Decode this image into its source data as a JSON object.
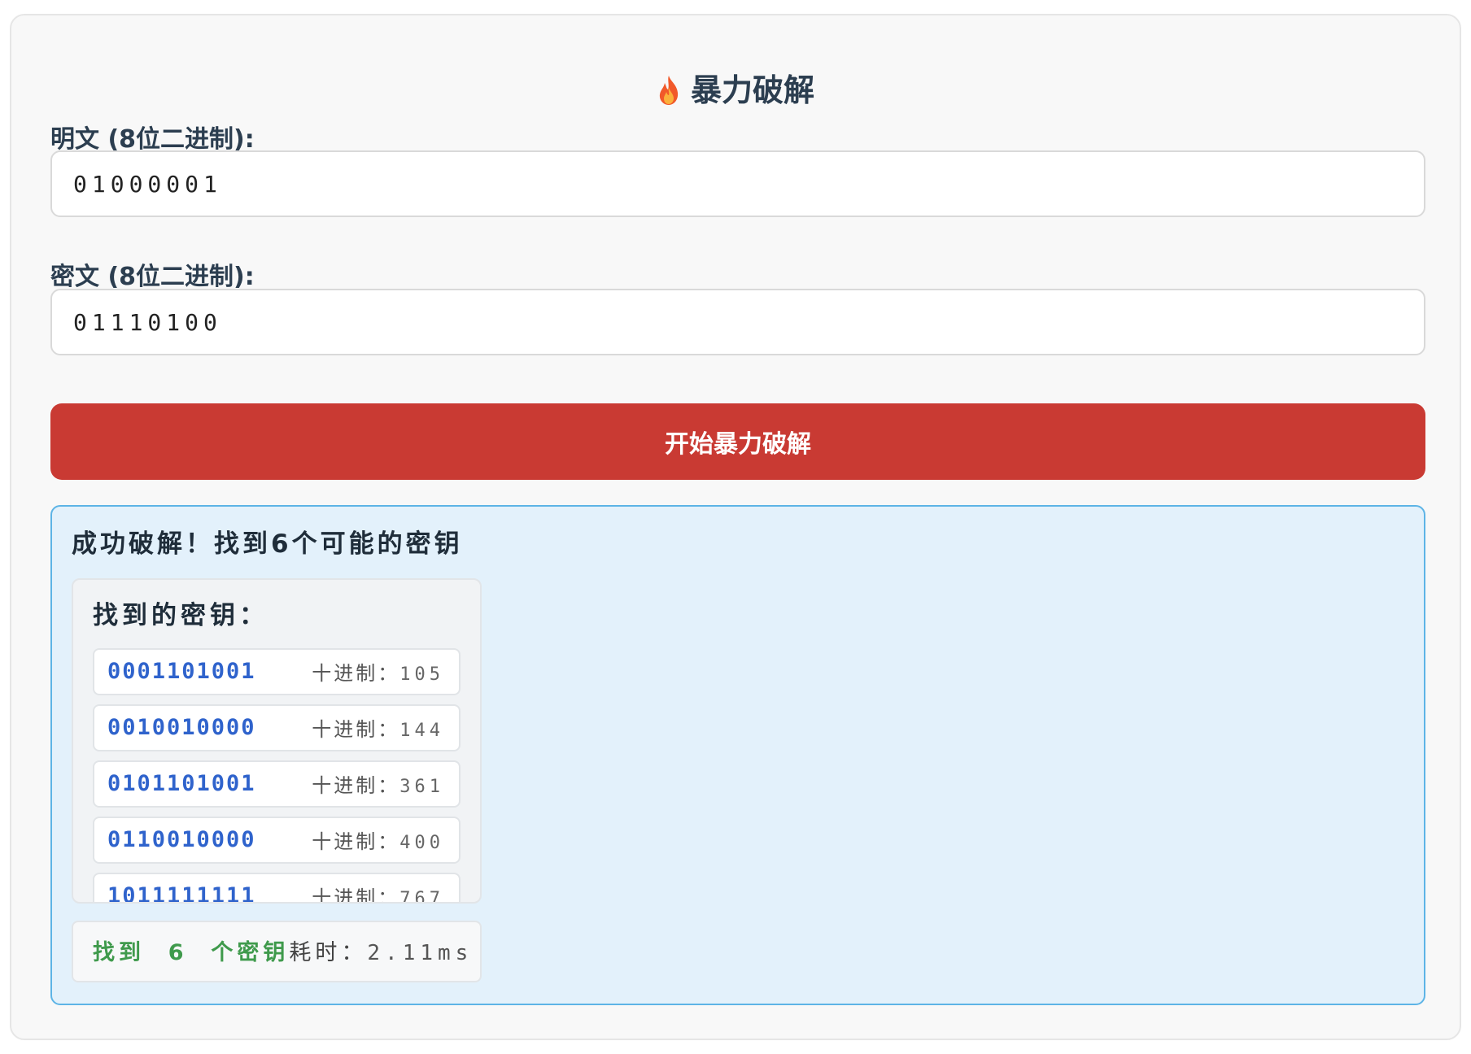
{
  "header": {
    "icon": "fire-icon",
    "title": "暴力破解"
  },
  "form": {
    "plaintext_label": "明文 (8位二进制):",
    "plaintext_value": "01000001",
    "ciphertext_label": "密文 (8位二进制):",
    "ciphertext_value": "01110100",
    "crack_button_label": "开始暴力破解"
  },
  "result": {
    "heading": "成功破解！找到6个可能的密钥",
    "keys_title": "找到的密钥：",
    "decimal_prefix": "十进制：",
    "keys": [
      {
        "binary": "0001101001",
        "decimal": "105"
      },
      {
        "binary": "0010010000",
        "decimal": "144"
      },
      {
        "binary": "0101101001",
        "decimal": "361"
      },
      {
        "binary": "0110010000",
        "decimal": "400"
      },
      {
        "binary": "1011111111",
        "decimal": "767"
      }
    ],
    "summary": {
      "found_text": "找到  6  个密钥",
      "elapsed_label": "耗时：",
      "elapsed_value": "2.11ms"
    }
  },
  "colors": {
    "button": "#c93a33",
    "result_bg": "#e3f1fb",
    "result_border": "#5db4e6",
    "key_binary": "#2f63cc",
    "found_count": "#3f9a4c"
  }
}
